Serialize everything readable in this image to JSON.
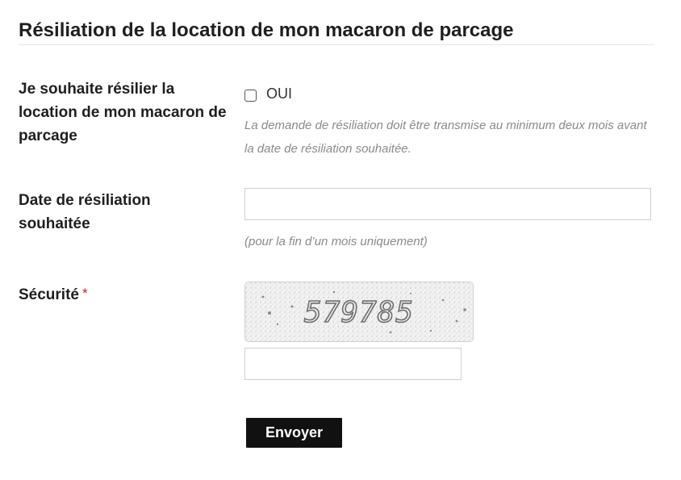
{
  "form": {
    "title": "Résiliation de la location de mon macaron de parcage",
    "terminate": {
      "label": "Je souhaite résilier la location de mon macaron de parcage",
      "checkbox_label": "OUI",
      "checked": false,
      "help": "La demande de résiliation doit être transmise au minimum deux mois avant la date de résiliation souhaitée."
    },
    "date": {
      "label": "Date de résiliation souhaitée",
      "value": "",
      "help": "(pour la fin d’un mois uniquement)"
    },
    "security": {
      "label": "Sécurité",
      "required_marker": "*",
      "captcha_text": "579785",
      "value": ""
    },
    "submit_label": "Envoyer"
  },
  "colors": {
    "text": "#1f1f1f",
    "help": "#8a8a8a",
    "required": "#c81e1e",
    "button_bg": "#111111",
    "button_text": "#ffffff",
    "border": "#cfcfcf"
  }
}
